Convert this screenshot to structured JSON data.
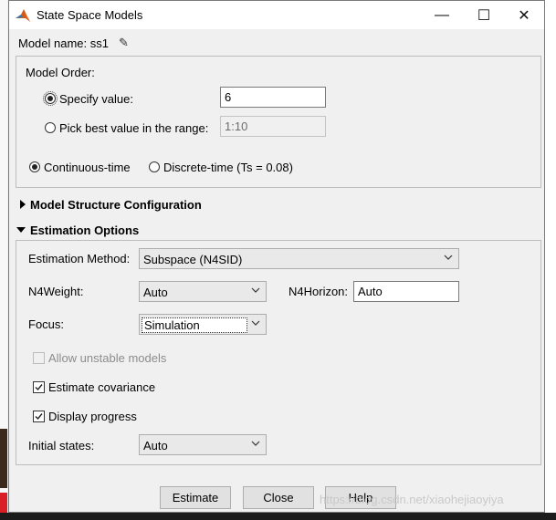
{
  "window": {
    "title": "State Space Models",
    "minimize": "—",
    "maximize": "☐",
    "close": "✕"
  },
  "model_name": {
    "text": "Model name: ss1"
  },
  "model_order": {
    "heading": "Model Order:",
    "specify_label": "Specify value:",
    "specify_value": "6",
    "pick_label": "Pick best value in the range:",
    "range_value": "1:10",
    "continuous_label": "Continuous-time",
    "discrete_label": "Discrete-time (Ts = 0.08)"
  },
  "structure": {
    "label": "Model Structure Configuration"
  },
  "estimation": {
    "label": "Estimation Options",
    "method_label": "Estimation Method:",
    "method_value": "Subspace (N4SID)",
    "n4weight_label": "N4Weight:",
    "n4weight_value": "Auto",
    "n4horizon_label": "N4Horizon:",
    "n4horizon_value": "Auto",
    "focus_label": "Focus:",
    "focus_value": "Simulation",
    "allow_unstable_label": "Allow unstable models",
    "estimate_cov_label": "Estimate covariance",
    "display_progress_label": "Display progress",
    "initial_states_label": "Initial states:",
    "initial_states_value": "Auto"
  },
  "buttons": {
    "estimate": "Estimate",
    "close": "Close",
    "help": "Help"
  },
  "watermark": "https://blog.csdn.net/xiaohejiaoyiya",
  "icons": [
    "matlab-logo-icon",
    "pencil-icon",
    "triangle-right-icon",
    "triangle-down-icon",
    "chevron-down-icon",
    "checkmark-icon"
  ],
  "colors": {
    "dialog_bg": "#f0f0f0",
    "titlebar_bg": "#ffffff",
    "button_bg": "#e1e1e1",
    "input_border": "#7a7a7a"
  }
}
